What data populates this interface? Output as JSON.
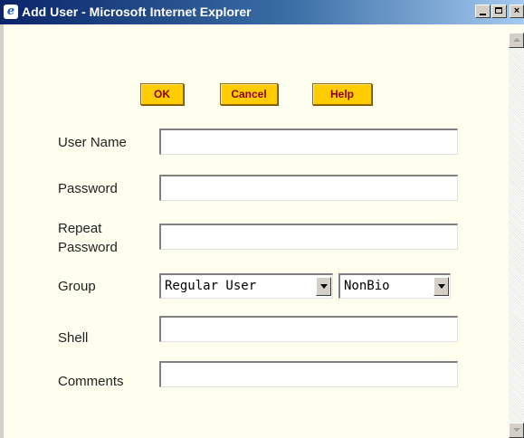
{
  "window": {
    "title": "Add User - Microsoft Internet Explorer",
    "minimize_glyph": "",
    "maximize_glyph": "",
    "close_glyph": "×"
  },
  "toolbar": {
    "ok_label": "OK",
    "cancel_label": "Cancel",
    "help_label": "Help"
  },
  "form": {
    "username": {
      "label": "User Name",
      "value": ""
    },
    "password": {
      "label": "Password",
      "value": ""
    },
    "repeat_password": {
      "label_line1": "Repeat",
      "label_line2": "Password",
      "value": ""
    },
    "group": {
      "label": "Group",
      "selected": "Regular User"
    },
    "biometric": {
      "selected": "NonBio"
    },
    "shell": {
      "label": "Shell",
      "value": ""
    },
    "comments": {
      "label": "Comments",
      "value": ""
    }
  },
  "colors": {
    "button_bg": "#ffcc00",
    "button_text": "#8b0000",
    "page_bg": "#fffff0",
    "titlebar": "#0a246a"
  },
  "icons": {
    "window_icon": "ie-logo-icon",
    "scroll_up": "scroll-up-arrow-icon",
    "scroll_down": "scroll-down-arrow-icon"
  }
}
